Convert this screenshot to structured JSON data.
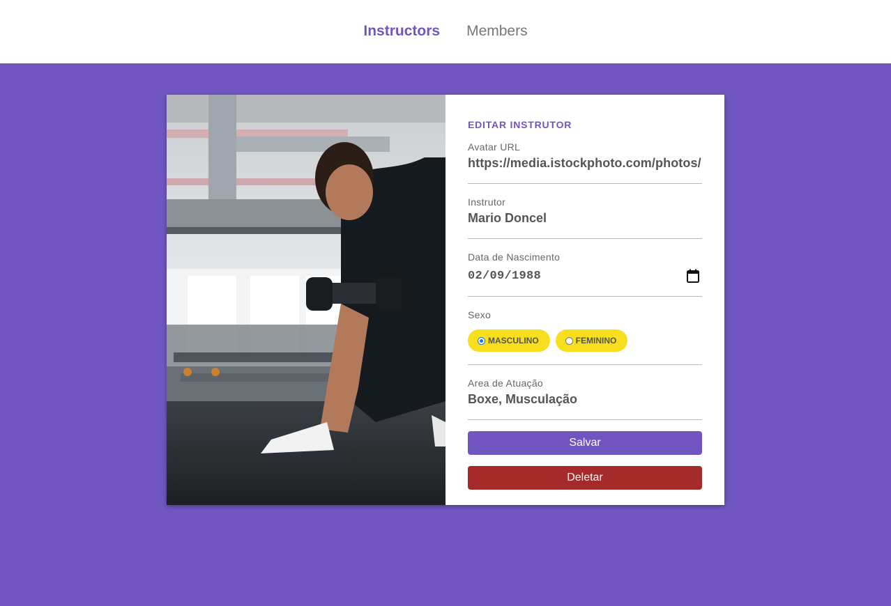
{
  "nav": {
    "instructors": "Instructors",
    "members": "Members"
  },
  "form": {
    "title": "EDITAR INSTRUTOR",
    "avatar": {
      "label": "Avatar URL",
      "value": "https://media.istockphoto.com/photos/h"
    },
    "instrutor": {
      "label": "Instrutor",
      "value": "Mario Doncel"
    },
    "nascimento": {
      "label": "Data de Nascimento",
      "value": "02/09/1988",
      "icon": "calendar-icon"
    },
    "sexo": {
      "label": "Sexo",
      "options": [
        {
          "label": "MASCULINO",
          "checked": true
        },
        {
          "label": "FEMININO",
          "checked": false
        }
      ]
    },
    "area": {
      "label": "Area de Atuação",
      "value": "Boxe, Musculação"
    },
    "save_label": "Salvar",
    "delete_label": "Deletar"
  },
  "colors": {
    "accent": "#7156c1",
    "radio_bg": "#f7df1e",
    "delete": "#a52a2a"
  }
}
